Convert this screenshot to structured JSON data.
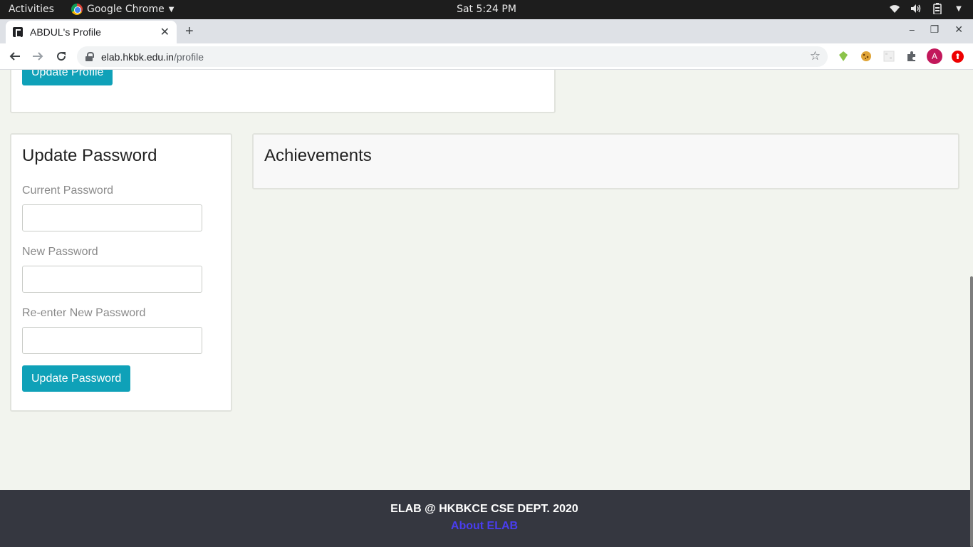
{
  "topbar": {
    "activities": "Activities",
    "app_name": "Google Chrome",
    "clock": "Sat  5:24 PM"
  },
  "browser": {
    "tab_title": "ABDUL's Profile",
    "url_host": "elab.hkbk.edu.in",
    "url_path": "/profile",
    "avatar_letter": "A"
  },
  "profile": {
    "update_profile_label": "Update Profile"
  },
  "password": {
    "heading": "Update Password",
    "current_label": "Current Password",
    "new_label": "New Password",
    "reenter_label": "Re-enter New Password",
    "current_value": "",
    "new_value": "",
    "reenter_value": "",
    "submit_label": "Update Password"
  },
  "achievements": {
    "heading": "Achievements"
  },
  "footer": {
    "copyright": "ELAB @ HKBKCE CSE DEPT. 2020",
    "about_link": "About ELAB"
  },
  "colors": {
    "accent": "#0fa1b8",
    "page_bg": "#f2f4ee",
    "footer_bg": "#353740",
    "link": "#4a3df0"
  }
}
